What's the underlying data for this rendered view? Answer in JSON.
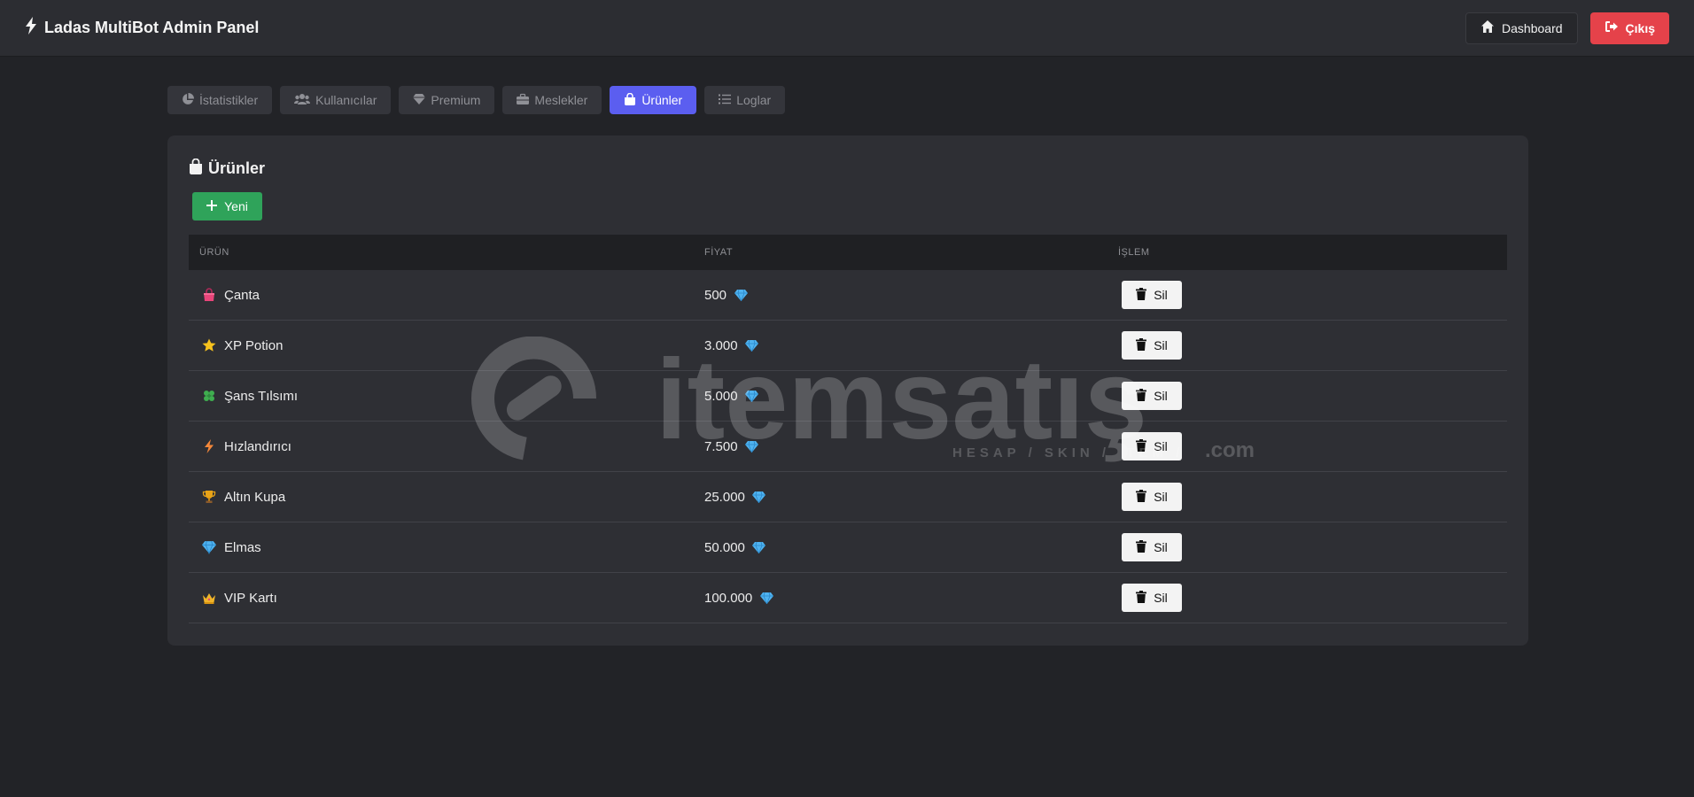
{
  "app": {
    "title": "Ladas MultiBot Admin Panel",
    "dashboard_label": "Dashboard",
    "exit_label": "Çıkış"
  },
  "tabs": [
    {
      "label": "İstatistikler",
      "icon": "pie-chart-icon",
      "active": false
    },
    {
      "label": "Kullanıcılar",
      "icon": "users-icon",
      "active": false
    },
    {
      "label": "Premium",
      "icon": "diamond-icon",
      "active": false
    },
    {
      "label": "Meslekler",
      "icon": "briefcase-icon",
      "active": false
    },
    {
      "label": "Ürünler",
      "icon": "shopping-bag-icon",
      "active": true
    },
    {
      "label": "Loglar",
      "icon": "list-icon",
      "active": false
    }
  ],
  "products": {
    "title": "Ürünler",
    "new_label": "Yeni",
    "headers": {
      "product": "ÜRÜN",
      "price": "FİYAT",
      "action": "İŞLEM"
    },
    "delete_label": "Sil",
    "rows": [
      {
        "name": "Çanta",
        "icon": "bag-emoji-icon",
        "price": "500"
      },
      {
        "name": "XP Potion",
        "icon": "star-emoji-icon",
        "price": "3.000"
      },
      {
        "name": "Şans Tılsımı",
        "icon": "clover-emoji-icon",
        "price": "5.000"
      },
      {
        "name": "Hızlandırıcı",
        "icon": "lightning-emoji-icon",
        "price": "7.500"
      },
      {
        "name": "Altın Kupa",
        "icon": "trophy-emoji-icon",
        "price": "25.000"
      },
      {
        "name": "Elmas",
        "icon": "gem-emoji-icon",
        "price": "50.000"
      },
      {
        "name": "VIP Kartı",
        "icon": "crown-emoji-icon",
        "price": "100.000"
      }
    ]
  },
  "watermark": {
    "brand": "itemsatış",
    "tagline": "HESAP / SKIN / ITEM /",
    "suffix": ".com"
  },
  "colors": {
    "accent": "#5b5ef0",
    "success": "#2fa35a",
    "danger": "#e5424a"
  }
}
